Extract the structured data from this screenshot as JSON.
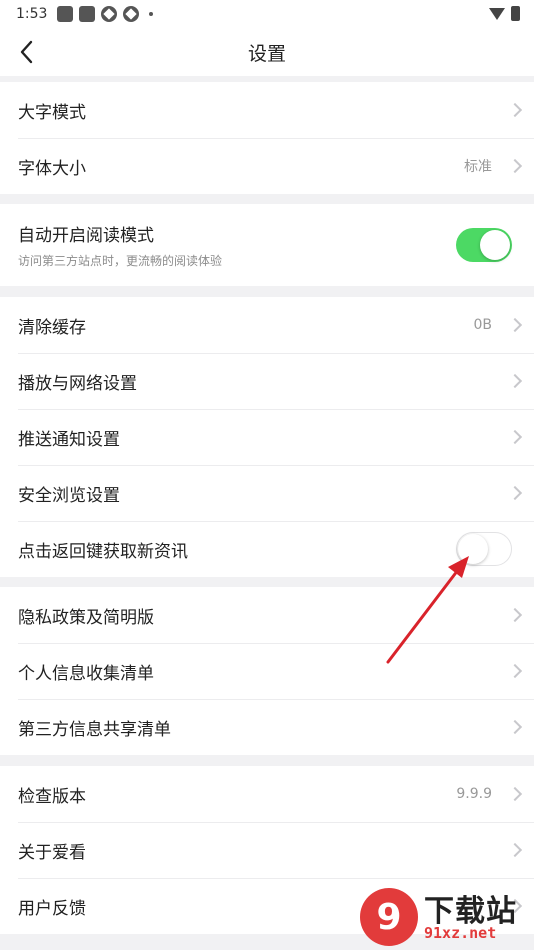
{
  "status_bar": {
    "time": "1:53",
    "icons": [
      "app-square-icon",
      "app-square-icon",
      "app-circle-icon",
      "app-circle-icon",
      "more-dot-icon"
    ],
    "right_icons": [
      "wifi-icon",
      "battery-icon"
    ]
  },
  "header": {
    "title": "设置",
    "back_icon": "chevron-left-icon"
  },
  "groups": [
    {
      "items": [
        {
          "label": "大字模式",
          "value": "",
          "control": "chevron"
        },
        {
          "label": "字体大小",
          "value": "标准",
          "control": "chevron"
        }
      ]
    },
    {
      "items": [
        {
          "label": "自动开启阅读模式",
          "subtitle": "访问第三方站点时，更流畅的阅读体验",
          "control": "toggle",
          "toggle_on": true
        }
      ]
    },
    {
      "items": [
        {
          "label": "清除缓存",
          "value": "0B",
          "control": "chevron"
        },
        {
          "label": "播放与网络设置",
          "value": "",
          "control": "chevron"
        },
        {
          "label": "推送通知设置",
          "value": "",
          "control": "chevron"
        },
        {
          "label": "安全浏览设置",
          "value": "",
          "control": "chevron"
        },
        {
          "label": "点击返回键获取新资讯",
          "control": "toggle",
          "toggle_on": false
        }
      ]
    },
    {
      "items": [
        {
          "label": "隐私政策及简明版",
          "value": "",
          "control": "chevron"
        },
        {
          "label": "个人信息收集清单",
          "value": "",
          "control": "chevron"
        },
        {
          "label": "第三方信息共享清单",
          "value": "",
          "control": "chevron"
        }
      ]
    },
    {
      "items": [
        {
          "label": "检查版本",
          "value": "9.9.9",
          "control": "chevron"
        },
        {
          "label": "关于爱看",
          "value": "",
          "control": "chevron"
        },
        {
          "label": "用户反馈",
          "value": "",
          "control": "chevron"
        }
      ]
    }
  ],
  "watermark": {
    "logo_text": "9",
    "name": "下载站",
    "url": "91xz.net"
  },
  "colors": {
    "toggle_on": "#4cd964",
    "annotation_arrow": "#d9232b",
    "background": "#f1f1f3"
  }
}
